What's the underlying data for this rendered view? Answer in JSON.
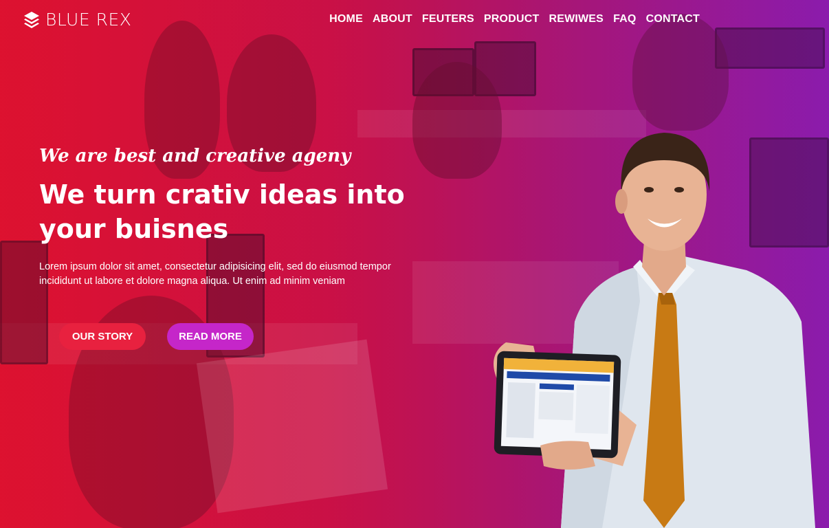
{
  "brand": {
    "name": "BLUE REX",
    "icon": "layers-icon"
  },
  "nav": {
    "items": [
      {
        "label": "HOME"
      },
      {
        "label": "ABOUT"
      },
      {
        "label": "FEUTERS"
      },
      {
        "label": "PRODUCT"
      },
      {
        "label": "REWIWES"
      },
      {
        "label": "FAQ"
      },
      {
        "label": "CONTACT"
      }
    ]
  },
  "hero": {
    "tagline": "We are best and creative ageny",
    "headline": "We turn crativ ideas into your buisnes",
    "description": "Lorem ipsum dolor sit amet, consectetur adipisicing elit, sed do eiusmod tempor incididunt ut labore et dolore magna aliqua. Ut enim ad minim veniam",
    "buttons": {
      "story": "OUR STORY",
      "more": "READ MORE"
    }
  },
  "colors": {
    "gradient_start": "#d8102e",
    "gradient_end": "#8a1aa8",
    "btn_story": "#e8213f",
    "btn_more": "#c526c9"
  }
}
